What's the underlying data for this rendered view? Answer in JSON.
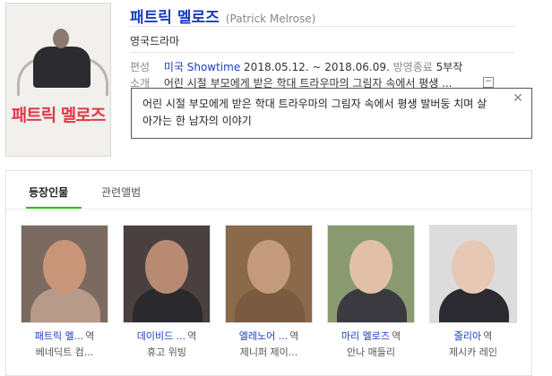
{
  "title": {
    "main": "패트릭 멜로즈",
    "sub": "(Patrick Melrose)"
  },
  "poster": {
    "text": "패트릭 멜로즈"
  },
  "genre": "영국드라마",
  "info": {
    "airing_label": "편성",
    "network": "미국 Showtime",
    "dates": "2018.05.12. ~ 2018.06.09.",
    "status": "방영종료",
    "episodes": "5부작",
    "summary_label": "소개",
    "summary_short": "어린 시절 부모에게 받은 학대 트라우마의 그림자 속에서 평생 ...",
    "toggle": "−"
  },
  "popup": {
    "text": "어린 시절 부모에게 받은 학대 트라우마의 그림자 속에서 평생 발버둥 치며 살아가는 한 남자의 이야기",
    "close": "✕"
  },
  "tabs": [
    {
      "label": "등장인물"
    },
    {
      "label": "관련앨범"
    }
  ],
  "cast": [
    {
      "character": "패트릭 멜...",
      "suffix": "역",
      "actor": "베네딕트 컴...",
      "skin": "#c99578",
      "bg": "#7a6a60",
      "cloth": "#b79a8a"
    },
    {
      "character": "데이비드 ...",
      "suffix": "역",
      "actor": "휴고 위빙",
      "skin": "#b88a72",
      "bg": "#4a4040",
      "cloth": "#2a2a2e"
    },
    {
      "character": "엘레노어 ...",
      "suffix": "역",
      "actor": "제니퍼 제이...",
      "skin": "#c49a7c",
      "bg": "#8a6a4a",
      "cloth": "#7a5a40"
    },
    {
      "character": "마리 멜로즈",
      "suffix": "역",
      "actor": "안나 매들리",
      "skin": "#e2c0a8",
      "bg": "#8a9a70",
      "cloth": "#3a3a40"
    },
    {
      "character": "줄리아",
      "suffix": "역",
      "actor": "제시카 레인",
      "skin": "#e8c8b4",
      "bg": "#dcdcdc",
      "cloth": "#2a2a30"
    }
  ]
}
